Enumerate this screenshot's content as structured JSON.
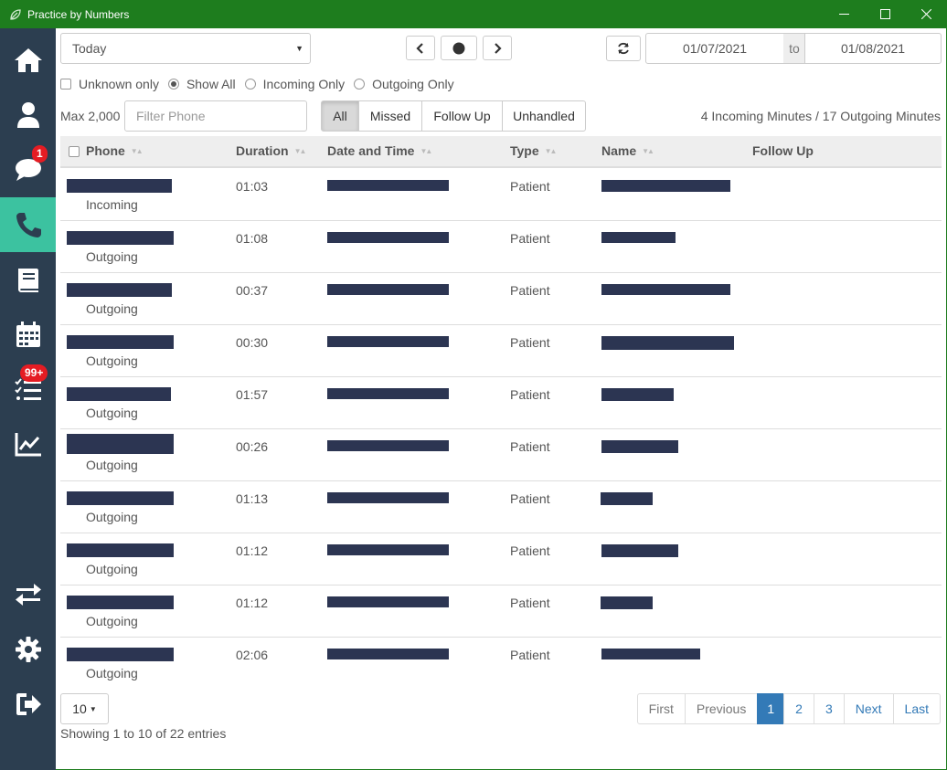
{
  "window": {
    "title": "Practice by Numbers"
  },
  "sidebar": {
    "items": [
      {
        "name": "home",
        "icon": "home-icon"
      },
      {
        "name": "patients",
        "icon": "user-icon"
      },
      {
        "name": "messages",
        "icon": "chat-icon",
        "badge": "1"
      },
      {
        "name": "calls",
        "icon": "phone-icon",
        "active": true
      },
      {
        "name": "book",
        "icon": "book-icon"
      },
      {
        "name": "calendar",
        "icon": "calendar-icon"
      },
      {
        "name": "tasks",
        "icon": "tasks-icon",
        "badge": "99+"
      },
      {
        "name": "reports",
        "icon": "chart-icon"
      },
      {
        "name": "switch",
        "icon": "transfer-icon"
      },
      {
        "name": "settings",
        "icon": "gear-icon"
      },
      {
        "name": "logout",
        "icon": "logout-icon"
      }
    ]
  },
  "toolbar": {
    "range_select": "Today",
    "date_from": "01/07/2021",
    "date_to_label": "to",
    "date_to": "01/08/2021"
  },
  "filters": {
    "unknown_only": "Unknown only",
    "show_all": "Show All",
    "incoming_only": "Incoming Only",
    "outgoing_only": "Outgoing Only",
    "selected": "Show All"
  },
  "search": {
    "max_label": "Max 2,000",
    "phone_placeholder": "Filter Phone"
  },
  "tabs": {
    "all": "All",
    "missed": "Missed",
    "follow_up": "Follow Up",
    "unhandled": "Unhandled",
    "active": "All"
  },
  "summary": "4 Incoming Minutes / 17 Outgoing Minutes",
  "table": {
    "headers": {
      "phone": "Phone",
      "duration": "Duration",
      "date_time": "Date and Time",
      "type": "Type",
      "name": "Name",
      "follow_up": "Follow Up"
    },
    "rows": [
      {
        "direction": "Incoming",
        "duration": "01:03",
        "type": "Patient"
      },
      {
        "direction": "Outgoing",
        "duration": "01:08",
        "type": "Patient"
      },
      {
        "direction": "Outgoing",
        "duration": "00:37",
        "type": "Patient"
      },
      {
        "direction": "Outgoing",
        "duration": "00:30",
        "type": "Patient"
      },
      {
        "direction": "Outgoing",
        "duration": "01:57",
        "type": "Patient"
      },
      {
        "direction": "Outgoing",
        "duration": "00:26",
        "type": "Patient"
      },
      {
        "direction": "Outgoing",
        "duration": "01:13",
        "type": "Patient"
      },
      {
        "direction": "Outgoing",
        "duration": "01:12",
        "type": "Patient"
      },
      {
        "direction": "Outgoing",
        "duration": "01:12",
        "type": "Patient"
      },
      {
        "direction": "Outgoing",
        "duration": "02:06",
        "type": "Patient"
      }
    ]
  },
  "footer": {
    "page_size": "10",
    "showing": "Showing 1 to 10 of 22 entries",
    "pager": {
      "first": "First",
      "previous": "Previous",
      "p1": "1",
      "p2": "2",
      "p3": "3",
      "next": "Next",
      "last": "Last",
      "current": "1"
    }
  },
  "colors": {
    "titlebar": "#1e7d1e",
    "sidebar": "#2c3e50",
    "active_nav": "#3cc2a0",
    "badge": "#e51c23",
    "link": "#337ab7"
  }
}
